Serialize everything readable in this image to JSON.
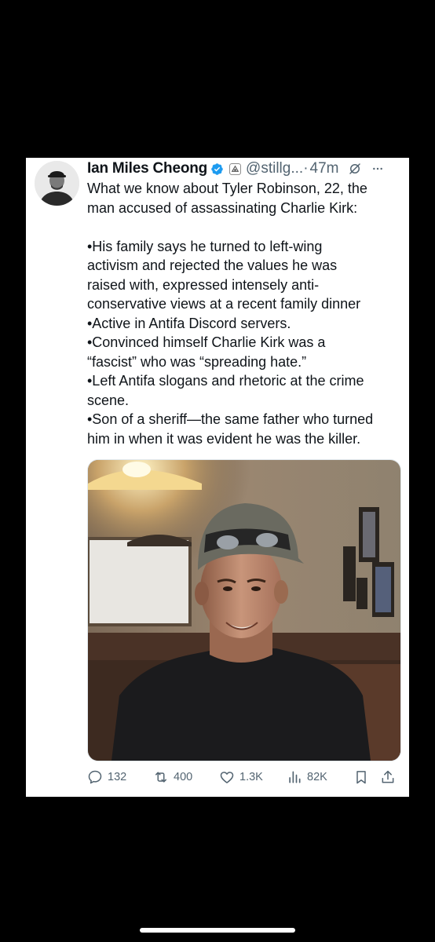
{
  "tweet": {
    "author_name": "Ian Miles Cheong",
    "handle": "@stillg...",
    "separator": "·",
    "time": "47m",
    "lines": [
      "What we know about Tyler Robinson, 22, the",
      "man accused of assassinating Charlie Kirk:",
      "",
      "•His family says he turned to left-wing",
      "activism and rejected the values he was",
      "raised with, expressed intensely anti-",
      "conservative views at a recent family dinner",
      "•Active in Antifa Discord servers.",
      "•Convinced himself Charlie Kirk was a",
      "“fascist” who was “spreading hate.”",
      "•Left Antifa slogans and rhetoric at the crime",
      "scene.",
      "•Son of a sheriff—the same father who turned",
      "him in when it was evident he was the killer."
    ]
  },
  "stats": {
    "replies": "132",
    "reposts": "400",
    "likes": "1.3K",
    "views": "82K"
  },
  "icons": {
    "verified": "verified-badge-icon",
    "affiliation": "affiliation-badge-icon",
    "grok": "grok-icon",
    "more": "more-icon",
    "reply": "reply-icon",
    "repost": "repost-icon",
    "like": "like-icon",
    "views": "views-icon",
    "bookmark": "bookmark-icon",
    "share": "share-icon"
  },
  "colors": {
    "verified_blue": "#1d9bf0",
    "text": "#0f1419",
    "secondary": "#536471",
    "background": "#000000",
    "card": "#ffffff"
  }
}
